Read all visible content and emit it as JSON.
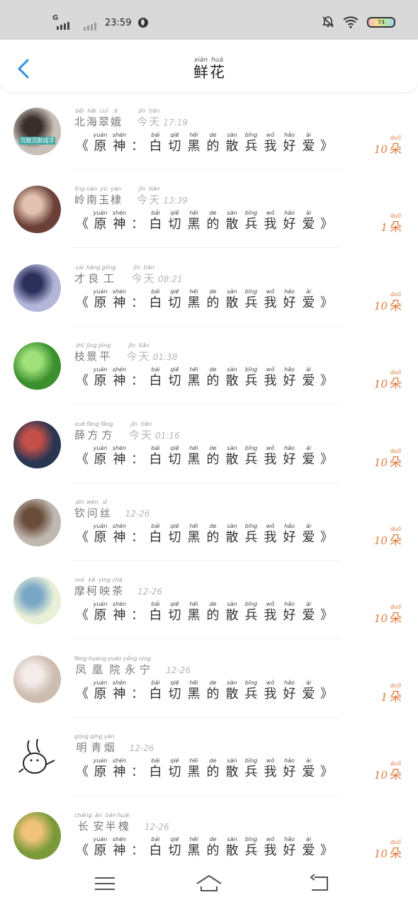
{
  "status_bar": {
    "network": "G",
    "time": "23:59",
    "battery": "74"
  },
  "header": {
    "title": [
      {
        "char": "鲜",
        "pinyin": "xiān"
      },
      {
        "char": "花",
        "pinyin": "huā"
      }
    ]
  },
  "message_text": [
    {
      "char": "《",
      "pinyin": ""
    },
    {
      "char": "原",
      "pinyin": "yuán"
    },
    {
      "char": "神",
      "pinyin": "shén"
    },
    {
      "char": "：",
      "pinyin": ""
    },
    {
      "char": "白",
      "pinyin": "bái"
    },
    {
      "char": "切",
      "pinyin": "qiē"
    },
    {
      "char": "黑",
      "pinyin": "hēi"
    },
    {
      "char": "的",
      "pinyin": "de"
    },
    {
      "char": "散",
      "pinyin": "sàn"
    },
    {
      "char": "兵",
      "pinyin": "bīng"
    },
    {
      "char": "我",
      "pinyin": "wǒ"
    },
    {
      "char": "好",
      "pinyin": "hǎo"
    },
    {
      "char": "爱",
      "pinyin": "ài"
    },
    {
      "char": "》",
      "pinyin": ""
    }
  ],
  "unit": {
    "char": "朵",
    "pinyin": "duǒ"
  },
  "today": [
    {
      "char": "今",
      "pinyin": "jīn"
    },
    {
      "char": "天",
      "pinyin": "tiān"
    }
  ],
  "items": [
    {
      "name": [
        {
          "char": "北",
          "pinyin": "běi"
        },
        {
          "char": "海",
          "pinyin": "hǎi"
        },
        {
          "char": "翠",
          "pinyin": "cuì"
        },
        {
          "char": "娥",
          "pinyin": "é"
        }
      ],
      "today": true,
      "time": "17:19",
      "count": "10",
      "avatar_bg": "#c9c0b8",
      "avatar_fg": "#3a2e2a",
      "avatar_text": "沉默沉默成浮",
      "avatar_text_bg": "#3aa6a0"
    },
    {
      "name": [
        {
          "char": "岭",
          "pinyin": "lǐng"
        },
        {
          "char": "南",
          "pinyin": "nán"
        },
        {
          "char": "玉",
          "pinyin": "yù"
        },
        {
          "char": "棣",
          "pinyin": "yán"
        }
      ],
      "today": true,
      "time": "13:39",
      "count": "1",
      "avatar_bg": "#6b4038",
      "avatar_fg": "#e2c1b0",
      "avatar_text": "",
      "avatar_text_bg": ""
    },
    {
      "name": [
        {
          "char": "才",
          "pinyin": "cái"
        },
        {
          "char": "良",
          "pinyin": "liáng"
        },
        {
          "char": "工",
          "pinyin": "gōng"
        }
      ],
      "today": true,
      "time": "08:21",
      "count": "10",
      "avatar_bg": "#b3b6d8",
      "avatar_fg": "#2c2f5a",
      "avatar_text": "",
      "avatar_text_bg": ""
    },
    {
      "name": [
        {
          "char": "枝",
          "pinyin": "zhī"
        },
        {
          "char": "景",
          "pinyin": "jǐng"
        },
        {
          "char": "平",
          "pinyin": "píng"
        }
      ],
      "today": true,
      "time": "01:38",
      "count": "10",
      "avatar_bg": "#3c8f2e",
      "avatar_fg": "#9fe07a",
      "avatar_text": "",
      "avatar_text_bg": ""
    },
    {
      "name": [
        {
          "char": "薛",
          "pinyin": "xuē"
        },
        {
          "char": "方",
          "pinyin": "fāng"
        },
        {
          "char": "方",
          "pinyin": "fāng"
        }
      ],
      "today": true,
      "time": "01:16",
      "count": "10",
      "avatar_bg": "#2a3552",
      "avatar_fg": "#c25048",
      "avatar_text": "",
      "avatar_text_bg": ""
    },
    {
      "name": [
        {
          "char": "钦",
          "pinyin": "qīn"
        },
        {
          "char": "问",
          "pinyin": "wèn"
        },
        {
          "char": "丝",
          "pinyin": "sī"
        }
      ],
      "today": false,
      "time": "12-26",
      "count": "10",
      "avatar_bg": "#bfb8b0",
      "avatar_fg": "#6a4c3a",
      "avatar_text": "",
      "avatar_text_bg": ""
    },
    {
      "name": [
        {
          "char": "摩",
          "pinyin": "mó"
        },
        {
          "char": "柯",
          "pinyin": "kē"
        },
        {
          "char": "映",
          "pinyin": "yìng"
        },
        {
          "char": "茶",
          "pinyin": "chá"
        }
      ],
      "today": false,
      "time": "12-26",
      "count": "10",
      "avatar_bg": "#e8f0d8",
      "avatar_fg": "#7aa7c6",
      "avatar_text": "",
      "avatar_text_bg": ""
    },
    {
      "name": [
        {
          "char": "凤",
          "pinyin": "fèng"
        },
        {
          "char": "凰",
          "pinyin": "huáng"
        },
        {
          "char": "院",
          "pinyin": "yuàn"
        },
        {
          "char": "永",
          "pinyin": "yǒng"
        },
        {
          "char": "宁",
          "pinyin": "níng"
        }
      ],
      "today": false,
      "time": "12-26",
      "count": "1",
      "avatar_bg": "#cdbcb0",
      "avatar_fg": "#f4ecea",
      "avatar_text": "",
      "avatar_text_bg": ""
    },
    {
      "name": [
        {
          "char": "明",
          "pinyin": "gōng"
        },
        {
          "char": "青",
          "pinyin": "qīng"
        },
        {
          "char": "烟",
          "pinyin": "yān"
        }
      ],
      "today": false,
      "time": "12-26",
      "count": "10",
      "avatar_bg": "#ffffff",
      "avatar_fg": "#222222",
      "avatar_text": "",
      "avatar_text_bg": ""
    },
    {
      "name": [
        {
          "char": "长",
          "pinyin": "cháng"
        },
        {
          "char": "安",
          "pinyin": "ān"
        },
        {
          "char": "半",
          "pinyin": "bàn"
        },
        {
          "char": "槐",
          "pinyin": "huái"
        }
      ],
      "today": false,
      "time": "12-26",
      "count": "10",
      "avatar_bg": "#7a9a3a",
      "avatar_fg": "#f0c27a",
      "avatar_text": "",
      "avatar_text_bg": ""
    }
  ],
  "nav": {
    "menu": "menu-icon",
    "home": "home-icon",
    "back": "back-icon"
  }
}
